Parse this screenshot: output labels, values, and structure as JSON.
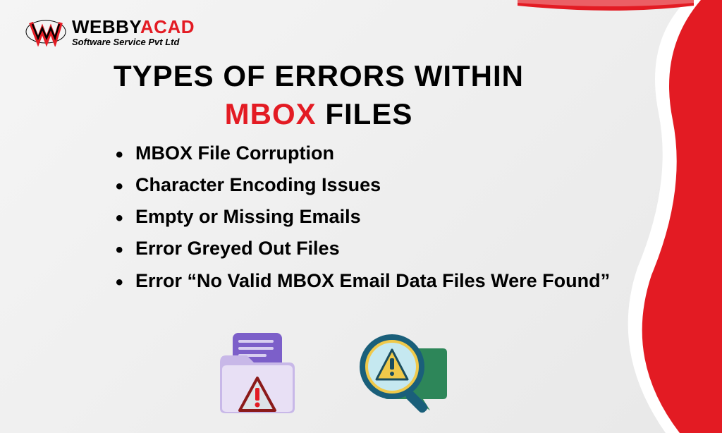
{
  "logo": {
    "brand_webby": "WEBBY",
    "brand_acad": "ACAD",
    "tagline": "Software Service Pvt Ltd"
  },
  "heading": {
    "line1": "TYPES OF ERRORS WITHIN",
    "mbox": "MBOX",
    "files": " FILES"
  },
  "errors": {
    "items": [
      "MBOX File Corruption",
      "Character Encoding Issues",
      "Empty or Missing Emails",
      "Error Greyed Out Files",
      " Error “No Valid MBOX Email Data Files Were Found”"
    ]
  },
  "icons": {
    "folder": "folder-warning-icon",
    "magnify": "magnify-warning-icon"
  }
}
